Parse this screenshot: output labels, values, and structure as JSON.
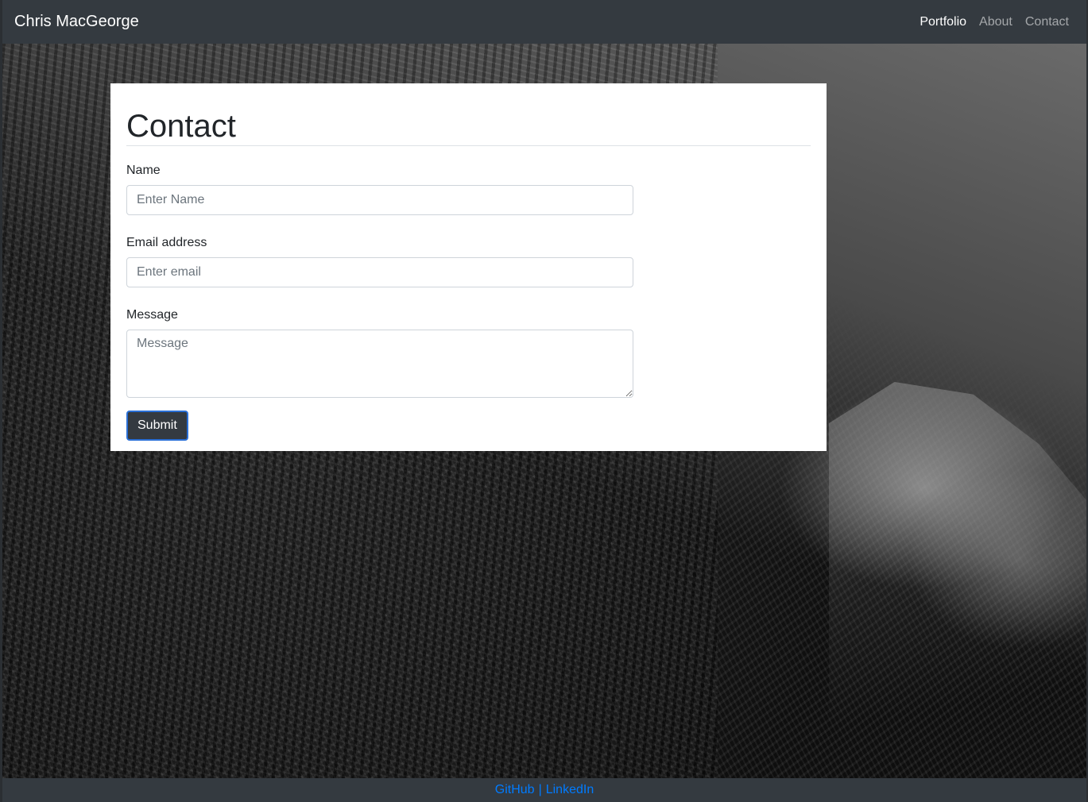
{
  "navbar": {
    "brand": "Chris MacGeorge",
    "links": [
      {
        "label": "Portfolio",
        "active": true
      },
      {
        "label": "About",
        "active": false
      },
      {
        "label": "Contact",
        "active": false
      }
    ]
  },
  "contact": {
    "title": "Contact",
    "fields": {
      "name": {
        "label": "Name",
        "placeholder": "Enter Name",
        "value": ""
      },
      "email": {
        "label": "Email address",
        "placeholder": "Enter email",
        "value": ""
      },
      "message": {
        "label": "Message",
        "placeholder": "Message",
        "value": ""
      }
    },
    "submit_label": "Submit"
  },
  "footer": {
    "github": "GitHub",
    "separator": "|",
    "linkedin": "LinkedIn"
  },
  "colors": {
    "navbar_bg": "#343a40",
    "link_blue": "#007bff",
    "focus_ring": "#2a6fd6"
  }
}
